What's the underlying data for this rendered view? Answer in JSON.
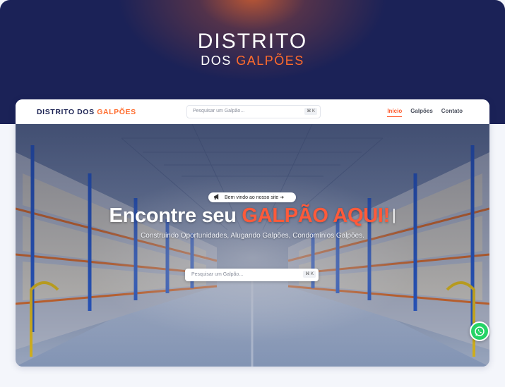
{
  "banner": {
    "title_line1": "DISTRITO",
    "title_line2_plain": "DOS ",
    "title_line2_accent": "GALPÕES"
  },
  "navbar": {
    "logo_plain": "DISTRITO DOS ",
    "logo_accent": "GALPÕES",
    "search_placeholder": "Pesquisar um Galpão...",
    "search_shortcut": "⌘ K",
    "links": [
      {
        "label": "Início",
        "active": true
      },
      {
        "label": "Galpões",
        "active": false
      },
      {
        "label": "Contato",
        "active": false
      }
    ]
  },
  "hero": {
    "badge_icon": "megaphone-icon",
    "badge_text": "Bem vindo ao nosso site ➔",
    "headline_plain": "Encontre seu ",
    "headline_accent": "GALPÃO AQUI!",
    "headline_cursor": "|",
    "subline": "Construindo Oportunidades, Alugando Galpões, Condomínios Galpões.",
    "search_placeholder": "Pesquisar um Galpão...",
    "search_shortcut": "⌘ K"
  },
  "floating": {
    "icon": "whatsapp-icon"
  },
  "colors": {
    "navy": "#1b2257",
    "accent_orange": "#ff6b2c",
    "headline_accent": "#ff5a3a",
    "whatsapp_green": "#25d366"
  }
}
